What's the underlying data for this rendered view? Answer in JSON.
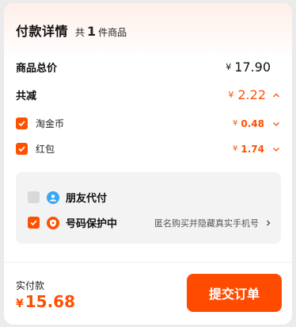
{
  "header": {
    "title": "付款详情",
    "count_prefix": "共",
    "count": "1",
    "count_suffix": "件商品"
  },
  "total": {
    "label": "商品总价",
    "currency": "¥",
    "amount": "17.90"
  },
  "reduction": {
    "label": "共减",
    "currency": "¥",
    "amount": "2.22",
    "expanded": true,
    "items": [
      {
        "label": "淘金币",
        "currency": "¥",
        "amount": "0.48",
        "checked": true
      },
      {
        "label": "红包",
        "currency": "¥",
        "amount": "1.74",
        "checked": true
      }
    ]
  },
  "options": {
    "friend_pay": {
      "label": "朋友代付",
      "checked": false,
      "icon": "friend-pay-icon"
    },
    "privacy": {
      "label": "号码保护中",
      "checked": true,
      "description": "匿名购买并隐藏真实手机号",
      "icon": "shield-icon"
    }
  },
  "footer": {
    "pay_label": "实付款",
    "currency": "¥",
    "amount": "15.68",
    "submit_label": "提交订单"
  },
  "colors": {
    "accent": "#ff5000",
    "button": "#ff4b00",
    "friend_icon": "#3aa7f5"
  }
}
